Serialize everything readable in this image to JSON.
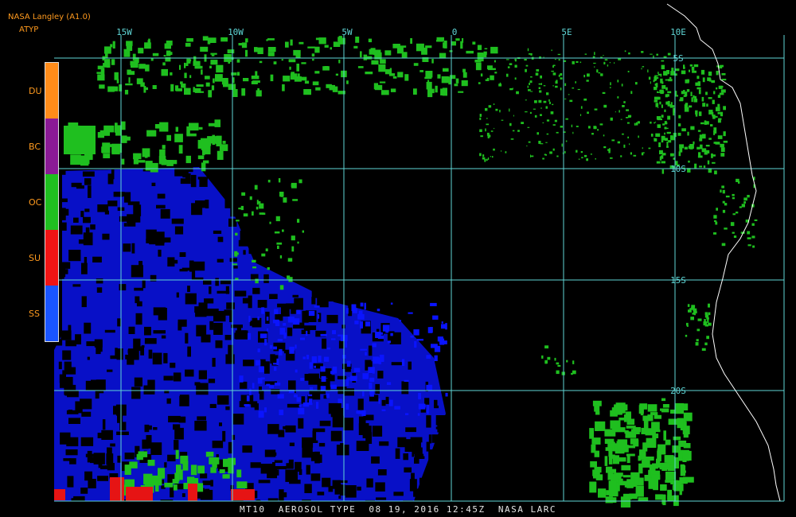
{
  "header": {
    "source": "NASA Langley (A1.0)",
    "product": "ATYP"
  },
  "legend": [
    {
      "label": "DU",
      "color": "#ff8c1a"
    },
    {
      "label": "BC",
      "color": "#8b1a96"
    },
    {
      "label": "OC",
      "color": "#1fbf1f"
    },
    {
      "label": "SU",
      "color": "#f01414"
    },
    {
      "label": "SS",
      "color": "#1a55ff"
    }
  ],
  "grid": {
    "color": "#5fd6d6",
    "lon_labels": [
      "15W",
      "10W",
      "5W",
      "0",
      "5E",
      "10E"
    ],
    "lat_labels": [
      "5S",
      "10S",
      "15S",
      "20S"
    ]
  },
  "caption": "MT10  AEROSOL TYPE  08 19, 2016 12:45Z  NASA LARC",
  "colors": {
    "background": "#000000",
    "coastline": "#ffffff",
    "oc": "#1fbf1f",
    "ss": "#0a14ff",
    "su": "#e61414"
  }
}
